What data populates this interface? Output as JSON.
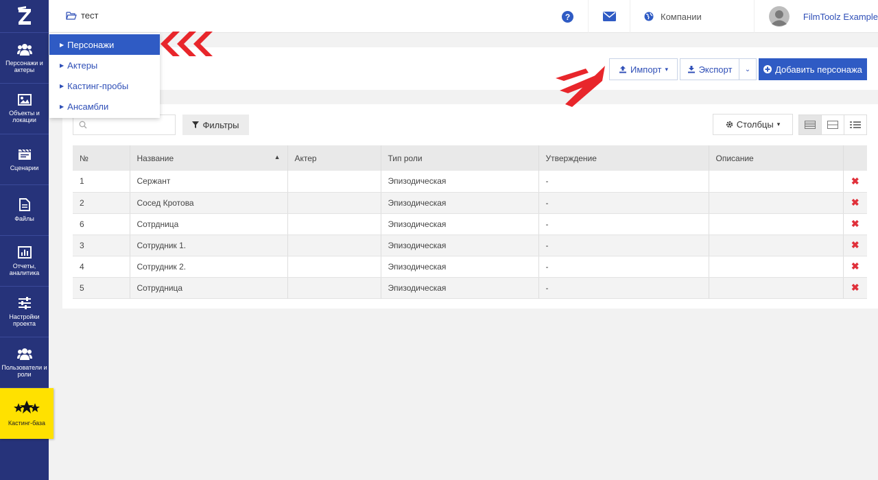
{
  "sidebar": {
    "logo": "Z",
    "items": [
      {
        "label": "Персонажи и актеры",
        "icon": "users-icon"
      },
      {
        "label": "Объекты и локации",
        "icon": "image-icon"
      },
      {
        "label": "Сценарии",
        "icon": "clapperboard-icon"
      },
      {
        "label": "Файлы",
        "icon": "file-icon"
      },
      {
        "label": "Отчеты, аналитика",
        "icon": "chart-icon"
      },
      {
        "label": "Настройки проекта",
        "icon": "sliders-icon"
      },
      {
        "label": "Пользователи и роли",
        "icon": "users-icon"
      },
      {
        "label": "Кастинг-база",
        "icon": "stars-icon"
      }
    ]
  },
  "topbar": {
    "breadcrumb": "тест",
    "companies": "Компании",
    "user_name": "FilmToolz Example"
  },
  "dropdown": {
    "items": [
      "Персонажи",
      "Актеры",
      "Кастинг-пробы",
      "Ансамбли"
    ]
  },
  "toolbar": {
    "import_label": "Импорт",
    "export_label": "Экспорт",
    "add_label": "Добавить персонажа",
    "filters_label": "Фильтры",
    "columns_label": "Столбцы"
  },
  "table": {
    "headers": [
      "№",
      "Название",
      "Актер",
      "Тип роли",
      "Утверждение",
      "Описание"
    ],
    "rows": [
      {
        "num": "1",
        "name": "Сержант",
        "actor": "",
        "role_type": "Эпизодическая",
        "approval": "-",
        "description": ""
      },
      {
        "num": "2",
        "name": "Сосед Кротова",
        "actor": "",
        "role_type": "Эпизодическая",
        "approval": "-",
        "description": ""
      },
      {
        "num": "6",
        "name": "Сотрдница",
        "actor": "",
        "role_type": "Эпизодическая",
        "approval": "-",
        "description": ""
      },
      {
        "num": "3",
        "name": "Сотрудник 1.",
        "actor": "",
        "role_type": "Эпизодическая",
        "approval": "-",
        "description": ""
      },
      {
        "num": "4",
        "name": "Сотрудник 2.",
        "actor": "",
        "role_type": "Эпизодическая",
        "approval": "-",
        "description": ""
      },
      {
        "num": "5",
        "name": "Сотрудница",
        "actor": "",
        "role_type": "Эпизодическая",
        "approval": "-",
        "description": ""
      }
    ]
  },
  "colors": {
    "sidebar": "#26337a",
    "primary": "#2f5bc4",
    "accent_yellow": "#ffe100",
    "delete": "#e0303a",
    "arrow": "#e8262b"
  }
}
